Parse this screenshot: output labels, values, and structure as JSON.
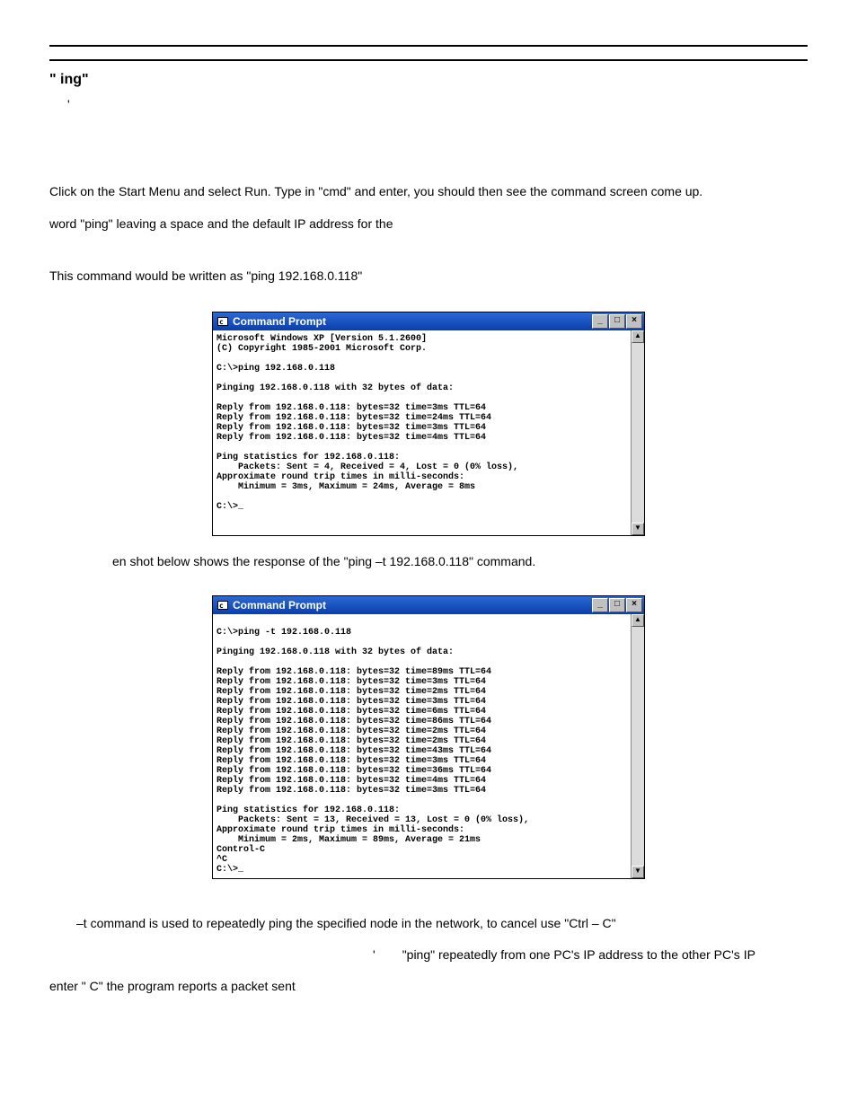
{
  "heading": "\"  ing\"",
  "apos": "'",
  "para1": "Click on the Start Menu and select Run. Type in \"cmd\" and enter, you should then see the command screen come up.",
  "para2": "word \"ping\" leaving a space and the default IP address for the",
  "para3": "This command would be written as \"ping 192.168.0.118\"",
  "cmd1": {
    "title": "Command Prompt",
    "lines": "Microsoft Windows XP [Version 5.1.2600]\n(C) Copyright 1985-2001 Microsoft Corp.\n\nC:\\>ping 192.168.0.118\n\nPinging 192.168.0.118 with 32 bytes of data:\n\nReply from 192.168.0.118: bytes=32 time=3ms TTL=64\nReply from 192.168.0.118: bytes=32 time=24ms TTL=64\nReply from 192.168.0.118: bytes=32 time=3ms TTL=64\nReply from 192.168.0.118: bytes=32 time=4ms TTL=64\n\nPing statistics for 192.168.0.118:\n    Packets: Sent = 4, Received = 4, Lost = 0 (0% loss),\nApproximate round trip times in milli-seconds:\n    Minimum = 3ms, Maximum = 24ms, Average = 8ms\n\nC:\\>_\n\n\n"
  },
  "caption2": "en shot below shows the response of the \"ping –t 192.168.0.118\" command.",
  "cmd2": {
    "title": "Command Prompt",
    "lines": "\nC:\\>ping -t 192.168.0.118\n\nPinging 192.168.0.118 with 32 bytes of data:\n\nReply from 192.168.0.118: bytes=32 time=89ms TTL=64\nReply from 192.168.0.118: bytes=32 time=3ms TTL=64\nReply from 192.168.0.118: bytes=32 time=2ms TTL=64\nReply from 192.168.0.118: bytes=32 time=3ms TTL=64\nReply from 192.168.0.118: bytes=32 time=6ms TTL=64\nReply from 192.168.0.118: bytes=32 time=86ms TTL=64\nReply from 192.168.0.118: bytes=32 time=2ms TTL=64\nReply from 192.168.0.118: bytes=32 time=2ms TTL=64\nReply from 192.168.0.118: bytes=32 time=43ms TTL=64\nReply from 192.168.0.118: bytes=32 time=3ms TTL=64\nReply from 192.168.0.118: bytes=32 time=36ms TTL=64\nReply from 192.168.0.118: bytes=32 time=4ms TTL=64\nReply from 192.168.0.118: bytes=32 time=3ms TTL=64\n\nPing statistics for 192.168.0.118:\n    Packets: Sent = 13, Received = 13, Lost = 0 (0% loss),\nApproximate round trip times in milli-seconds:\n    Minimum = 2ms, Maximum = 89ms, Average = 21ms\nControl-C\n^C\nC:\\>_"
  },
  "para4": "–t command is used to repeatedly ping the specified node in the network, to cancel use \"Ctrl – C\"",
  "para5_prefix": "'",
  "para5": "\"ping\" repeatedly from one PC's IP address to the other PC's IP",
  "para6": "enter \"      C\" the program reports a packet sent",
  "wbtn_min": "_",
  "wbtn_max": "□",
  "wbtn_close": "×",
  "arrow_up": "▲",
  "arrow_down": "▼"
}
